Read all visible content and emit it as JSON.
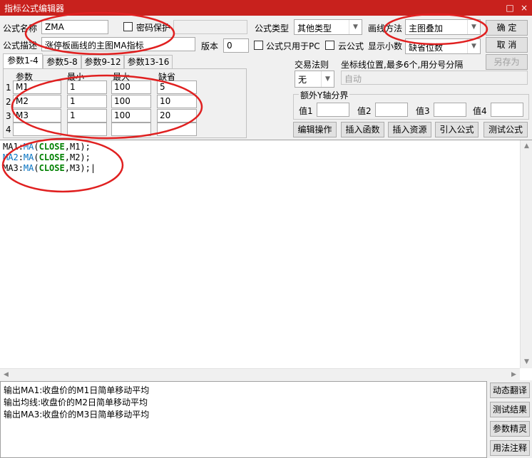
{
  "window": {
    "title": "指标公式编辑器",
    "controls": [
      "□",
      "×"
    ]
  },
  "formula": {
    "name_label": "公式名称",
    "name_value": "ZMA",
    "password_label": "密码保护",
    "desc_label": "公式描述",
    "desc_value": "涨停板画线的主图MA指标",
    "type_label": "公式类型",
    "type_value": "其他类型",
    "draw_label": "画线方法",
    "draw_value": "主图叠加",
    "version_label": "版本",
    "version_value": "0",
    "pc_only_label": "公式只用于PC",
    "cloud_label": "云公式",
    "decimals_label": "显示小数",
    "decimals_value": "缺省位数"
  },
  "buttons": {
    "confirm": "确  定",
    "cancel": "取  消",
    "save_as": "另存为",
    "edit_ops": "编辑操作",
    "insert_func": "插入函数",
    "insert_resource": "插入资源",
    "import_formula": "引入公式",
    "test_formula": "测试公式"
  },
  "tabs": [
    "参数1-4",
    "参数5-8",
    "参数9-12",
    "参数13-16"
  ],
  "params": {
    "headers": [
      "参数",
      "最小",
      "最大",
      "缺省"
    ],
    "rows": [
      {
        "idx": "1",
        "name": "M1",
        "min": "1",
        "max": "100",
        "def": "5"
      },
      {
        "idx": "2",
        "name": "M2",
        "min": "1",
        "max": "100",
        "def": "10"
      },
      {
        "idx": "3",
        "name": "M3",
        "min": "1",
        "max": "100",
        "def": "20"
      },
      {
        "idx": "4",
        "name": "",
        "min": "",
        "max": "",
        "def": ""
      }
    ]
  },
  "trade": {
    "rule_label": "交易法则",
    "rule_value": "无",
    "coord_label": "坐标线位置,最多6个,用分号分隔",
    "coord_value": "自动"
  },
  "yaxis": {
    "group_label": "额外Y轴分界",
    "labels": [
      "值1",
      "值2",
      "值3",
      "值4"
    ]
  },
  "code_lines": [
    {
      "var": "MA1",
      "fn": "MA",
      "arg1": "CLOSE",
      "arg2": "M1",
      "end": ");"
    },
    {
      "var": "MA2",
      "fn": "MA",
      "arg1": "CLOSE",
      "arg2": "M2",
      "end": ");"
    },
    {
      "var": "MA3",
      "fn": "MA",
      "arg1": "CLOSE",
      "arg2": "M3",
      "end": ");|"
    }
  ],
  "notes": [
    "输出MA1:收盘价的M1日简单移动平均",
    "输出均线:收盘价的M2日简单移动平均",
    "输出MA3:收盘价的M3日简单移动平均"
  ],
  "side_buttons": [
    "动态翻译",
    "测试结果",
    "参数精灵",
    "用法注释"
  ],
  "colors": {
    "titlebar": "#c8211d",
    "annotation": "#e02020",
    "keyword": "#0070c0",
    "constant": "#008000"
  }
}
